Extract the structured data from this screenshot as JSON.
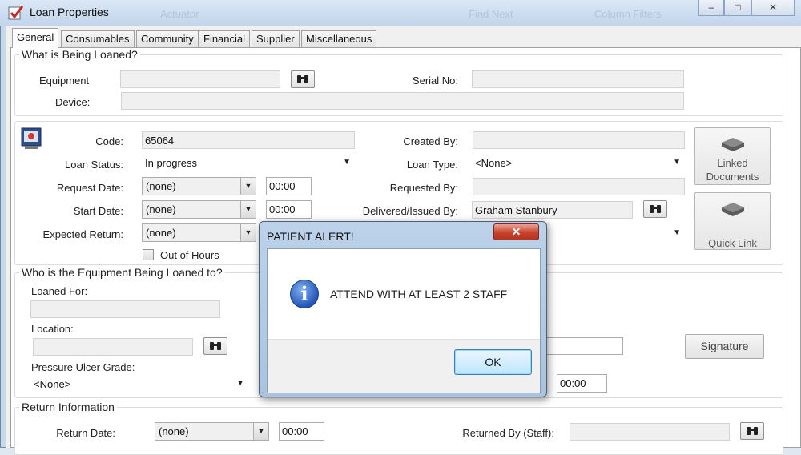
{
  "window": {
    "title": "Loan Properties",
    "min": "–",
    "max": "□",
    "close": "✕"
  },
  "tabs": [
    "General",
    "Consumables",
    "Community",
    "Financial",
    "Supplier",
    "Miscellaneous"
  ],
  "what": {
    "title": "What is Being Loaned?",
    "equipment_label": "Equipment",
    "serial_label": "Serial No:",
    "device_label": "Device:"
  },
  "details": {
    "code_label": "Code:",
    "code_value": "65064",
    "status_label": "Loan Status:",
    "status_value": "In progress",
    "request_label": "Request Date:",
    "request_value": "(none)",
    "request_time": "00:00",
    "start_label": "Start Date:",
    "start_value": "(none)",
    "start_time": "00:00",
    "expected_label": "Expected Return:",
    "expected_value": "(none)",
    "out_of_hours_label": "Out of Hours",
    "created_label": "Created By:",
    "type_label": "Loan Type:",
    "type_value": "<None>",
    "requested_label": "Requested By:",
    "delivered_label": "Delivered/Issued By:",
    "delivered_value": "Graham Stanbury",
    "linked_docs_label": "Linked Documents",
    "quick_link_label": "Quick Link"
  },
  "loaned_to": {
    "title": "Who is the Equipment Being Loaned to?",
    "loaned_for_label": "Loaned For:",
    "location_label": "Location:",
    "pressure_label": "Pressure Ulcer Grade:",
    "pressure_value": "<None>",
    "time_value": "00:00",
    "signature_label": "Signature"
  },
  "return_info": {
    "title": "Return Information",
    "return_date_label": "Return Date:",
    "return_date_value": "(none)",
    "return_time": "00:00",
    "returned_by_label": "Returned By (Staff):"
  },
  "dialog": {
    "title": "PATIENT ALERT!",
    "close": "✕",
    "message": "ATTEND WITH AT LEAST 2 STAFF",
    "ok_label": "OK"
  },
  "background_toolbar": [
    "Actuator",
    "Find Next",
    "Column Filters"
  ],
  "colors": {
    "accent": "#3c7fb1",
    "dialog_close": "#c8412b",
    "info": "#2356b8"
  }
}
